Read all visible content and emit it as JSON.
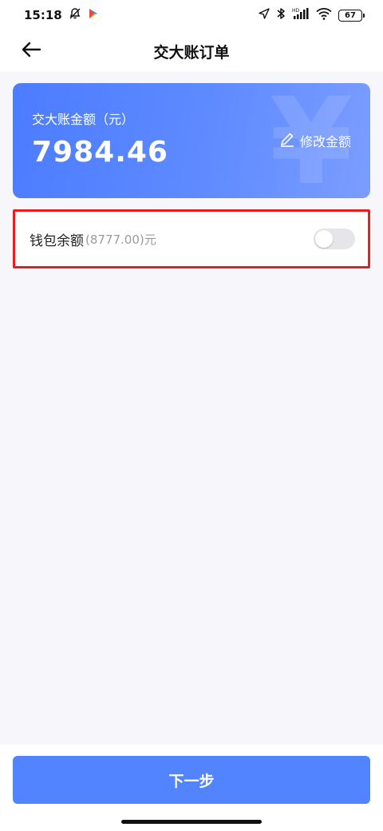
{
  "status_bar": {
    "time": "15:18",
    "icons": [
      "notification-off-icon",
      "play-store-icon",
      "location-icon",
      "bluetooth-icon",
      "hd-signal-icon",
      "wifi-icon"
    ],
    "battery": "67"
  },
  "header": {
    "title": "交大账订单",
    "back_icon": "arrow-left-icon"
  },
  "amount_card": {
    "label": "交大账金额（元）",
    "value": "7984.46",
    "edit_label": "修改金额",
    "edit_icon": "pencil-icon",
    "watermark": "¥",
    "gradient_from": "#4c7cff",
    "gradient_to": "#7b9dff"
  },
  "wallet": {
    "label": "钱包余额",
    "balance": "(8777.00)元",
    "toggle_on": false,
    "highlight_color": "#ee1d1d"
  },
  "footer": {
    "next_label": "下一步",
    "button_color": "#5384ff"
  }
}
